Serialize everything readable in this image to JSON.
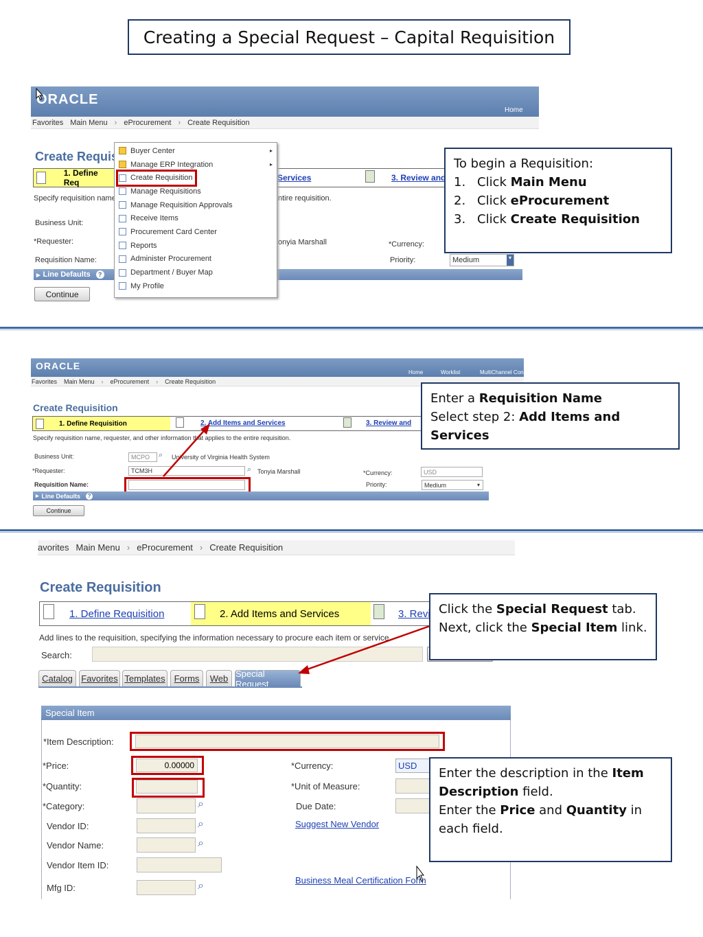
{
  "title": "Creating a Special Request –  Capital Requisition",
  "callouts": {
    "c1": {
      "intro": "To begin a Requisition:",
      "steps": [
        {
          "n": "1.",
          "pre": "Click ",
          "bold": "Main Menu"
        },
        {
          "n": "2.",
          "pre": "Click ",
          "bold": "eProcurement"
        },
        {
          "n": "3.",
          "pre": "Click ",
          "bold": "Create Requisition"
        }
      ]
    },
    "c2": {
      "l1_pre": "Enter a ",
      "l1_bold": "Requisition Name",
      "l2_pre": "Select step 2: ",
      "l2_bold": "Add Items and Services"
    },
    "c3": {
      "l1_pre": "Click the ",
      "l1_bold": "Special Request",
      "l1_post": " tab.",
      "l2_pre": "Next, click the ",
      "l2_bold": "Special Item",
      "l2_post": " link."
    },
    "c4": {
      "l1_pre": "Enter the description in the ",
      "l1_bold": "Item Description",
      "l1_post": " field.",
      "l2_pre": "Enter the ",
      "l2_bold1": "Price",
      "l2_mid": " and ",
      "l2_bold2": "Quantity",
      "l2_post": " in each field."
    }
  },
  "shot1": {
    "logo": "ORACLE",
    "home": "Home",
    "crumbs": [
      "Favorites",
      "Main Menu",
      "eProcurement",
      "Create Requisition"
    ],
    "heading": "Create Requisi",
    "step1": "1. Define Req",
    "step2_partial": "Services",
    "step3_partial": "3. Review and",
    "instruction": "Specify requisition name,",
    "instruction_tail": "ntire requisition.",
    "labels": {
      "bu": "Business Unit:",
      "req": "*Requester:",
      "name": "Requisition Name:",
      "currency": "*Currency:",
      "priority": "Priority:"
    },
    "requester_partial": "onyia Marshall",
    "priority_value": "Medium",
    "line_defaults": "Line Defaults",
    "continue": "Continue",
    "menu": [
      {
        "label": "Buyer Center",
        "type": "folder",
        "arrow": true
      },
      {
        "label": "Manage ERP Integration",
        "type": "folder",
        "arrow": true
      },
      {
        "label": "Create Requisition",
        "type": "page",
        "arrow": false
      },
      {
        "label": "Manage Requisitions",
        "type": "page",
        "arrow": false
      },
      {
        "label": "Manage Requisition Approvals",
        "type": "page",
        "arrow": false
      },
      {
        "label": "Receive Items",
        "type": "page",
        "arrow": false
      },
      {
        "label": "Procurement Card Center",
        "type": "page",
        "arrow": false
      },
      {
        "label": "Reports",
        "type": "page",
        "arrow": false
      },
      {
        "label": "Administer Procurement",
        "type": "page",
        "arrow": false
      },
      {
        "label": "Department / Buyer Map",
        "type": "page",
        "arrow": false
      },
      {
        "label": "My Profile",
        "type": "page",
        "arrow": false
      }
    ]
  },
  "shot2": {
    "logo": "ORACLE",
    "toplinks": [
      "Home",
      "Worklist",
      "MultiChannel Con"
    ],
    "crumbs": [
      "Favorites",
      "Main Menu",
      "eProcurement",
      "Create Requisition"
    ],
    "heading": "Create Requisition",
    "step1": "1. Define Requisition",
    "step2": "2. Add Items and Services",
    "step3": "3. Review and",
    "instruction": "Specify requisition name, requester, and other information that applies to the entire requisition.",
    "labels": {
      "bu": "Business Unit:",
      "req": "*Requester:",
      "name": "Requisition Name:",
      "currency": "*Currency:",
      "priority": "Priority:"
    },
    "bu_value": "MCPO",
    "bu_desc": "University of Virginia Health System",
    "req_value": "TCM3H",
    "req_name": "Tonyia Marshall",
    "currency_value": "USD",
    "priority_value": "Medium",
    "line_defaults": "Line Defaults",
    "continue": "Continue"
  },
  "shot3": {
    "crumbs": [
      "avorites",
      "Main Menu",
      "eProcurement",
      "Create Requisition"
    ],
    "heading": "Create Requisition",
    "step1": "1. Define Requisition",
    "step2": "2. Add Items and Services",
    "step3": "3. Revie",
    "instruction": "Add lines to the requisition, specifying the information necessary to procure each item or service.",
    "search_label": "Search:",
    "tabs": [
      "Catalog",
      "Favorites",
      "Templates",
      "Forms",
      "Web",
      "Special Request"
    ],
    "panel_title": "Special Item",
    "labels": {
      "desc": "*Item Description:",
      "price": "*Price:",
      "qty": "*Quantity:",
      "cat": "*Category:",
      "vid": "Vendor ID:",
      "vname": "Vendor Name:",
      "vitem": "Vendor Item ID:",
      "mfg": "Mfg ID:",
      "currency": "*Currency:",
      "uom": "*Unit of Measure:",
      "due": "Due Date:"
    },
    "price_value": "0.00000",
    "currency_value": "USD",
    "suggest_vendor": "Suggest New Vendor",
    "meal_form": "Business Meal Certification Form"
  },
  "colors": {
    "accent": "#1f3864",
    "highlight": "#c00000",
    "oracle_bar": "#6b8ab8",
    "step_active": "#ffff88",
    "link": "#1d3fb3"
  }
}
